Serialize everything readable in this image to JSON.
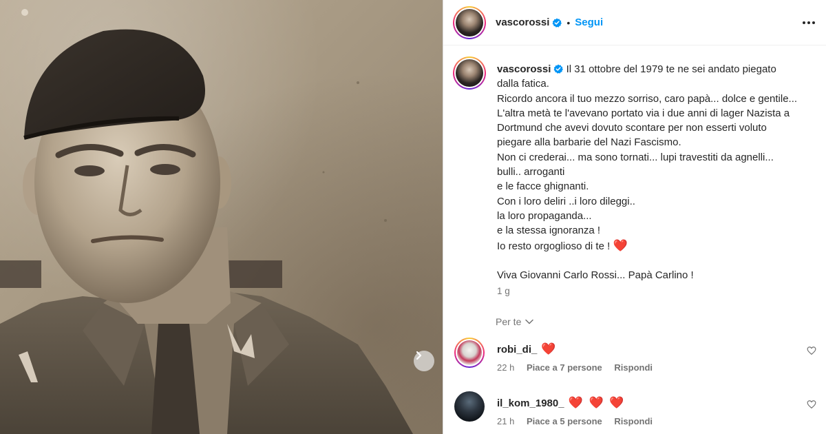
{
  "post": {
    "username": "vascorossi",
    "follow_label": "Segui",
    "separator": "•",
    "caption_lines": [
      "Il 31 ottobre del 1979 te ne sei andato piegato",
      "dalla fatica.",
      "Ricordo ancora il tuo mezzo sorriso, caro papà... dolce e gentile...",
      "L'altra metà te l'avevano portato via i due anni di lager Nazista a",
      "Dortmund che avevi dovuto scontare per non esserti voluto",
      "piegare alla barbarie del Nazi Fascismo.",
      "Non ci crederai... ma sono tornati... lupi travestiti da agnelli...",
      "bulli.. arroganti",
      "e le facce ghignanti.",
      "Con i loro deliri ..i loro dileggi..",
      "la loro propaganda...",
      "e la stessa ignoranza !",
      "Io resto orgoglioso di te !"
    ],
    "caption_heart": "❤️",
    "caption_final": "Viva Giovanni Carlo Rossi... Papà Carlino !",
    "time_ago": "1 g",
    "translation_label": "Per te"
  },
  "comments": [
    {
      "username": "robi_di_",
      "emoji": "❤️",
      "time": "22 h",
      "likes": "Piace a 7 persone",
      "reply_label": "Rispondi"
    },
    {
      "username": "il_kom_1980_",
      "emoji": "❤️ ❤️ ❤️",
      "time": "21 h",
      "likes": "Piace a 5 persone",
      "reply_label": "Rispondi"
    }
  ],
  "colors": {
    "accent_blue": "#0095f6",
    "heart_red": "#ed1d34",
    "secondary_text": "#737373"
  },
  "icons": {
    "verified": "verified-badge-icon",
    "more": "more-options-icon",
    "carousel_next": "chevron-right-icon",
    "translation": "chevron-down-icon",
    "comment_like": "heart-outline-icon"
  }
}
